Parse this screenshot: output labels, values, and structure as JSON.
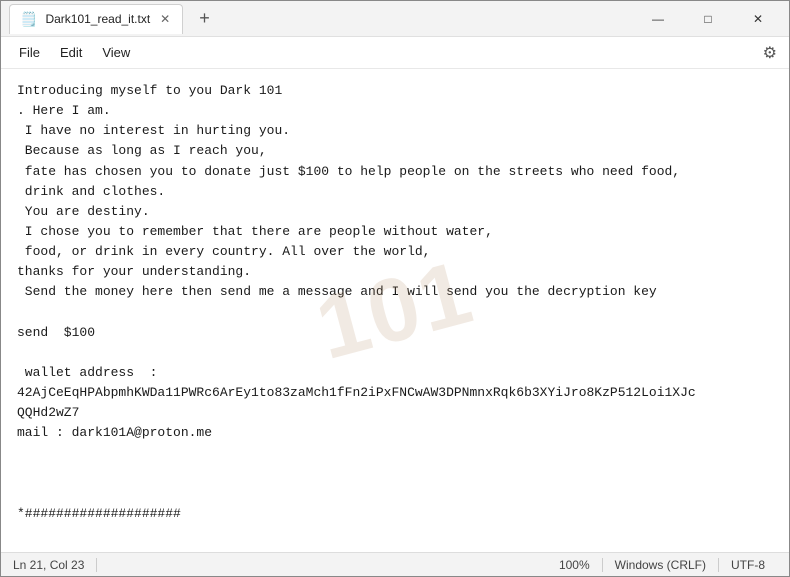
{
  "window": {
    "title": "Dark101_read_it.txt"
  },
  "tabs": [
    {
      "label": "Dark101_read_it.txt",
      "icon": "📄",
      "active": true
    }
  ],
  "controls": {
    "minimize": "—",
    "maximize": "□",
    "close": "✕",
    "add": "+"
  },
  "menu": {
    "items": [
      "File",
      "Edit",
      "View"
    ]
  },
  "content": {
    "text": "Introducing myself to you Dark 101\n. Here I am.\n I have no interest in hurting you.\n Because as long as I reach you,\n fate has chosen you to donate just $100 to help people on the streets who need food,\n drink and clothes.\n You are destiny.\n I chose you to remember that there are people without water,\n food, or drink in every country. All over the world,\nthanks for your understanding.\n Send the money here then send me a message and I will send you the decryption key\n\nsend  $100\n\n wallet address  :\n42AjCeEqHPAbpmhKWDa11PWRc6ArEy1to83zaMch1fFn2iPxFNCwAW3DPNmnxRqk6b3XYiJro8KzP512Loi1XJc\nQQHd2wZ7\nmail : dark101A@proton.me\n\n\n\n*####################"
  },
  "statusbar": {
    "position": "Ln 21, Col 23",
    "zoom": "100%",
    "line_ending": "Windows (CRLF)",
    "encoding": "UTF-8"
  },
  "watermark": "101"
}
